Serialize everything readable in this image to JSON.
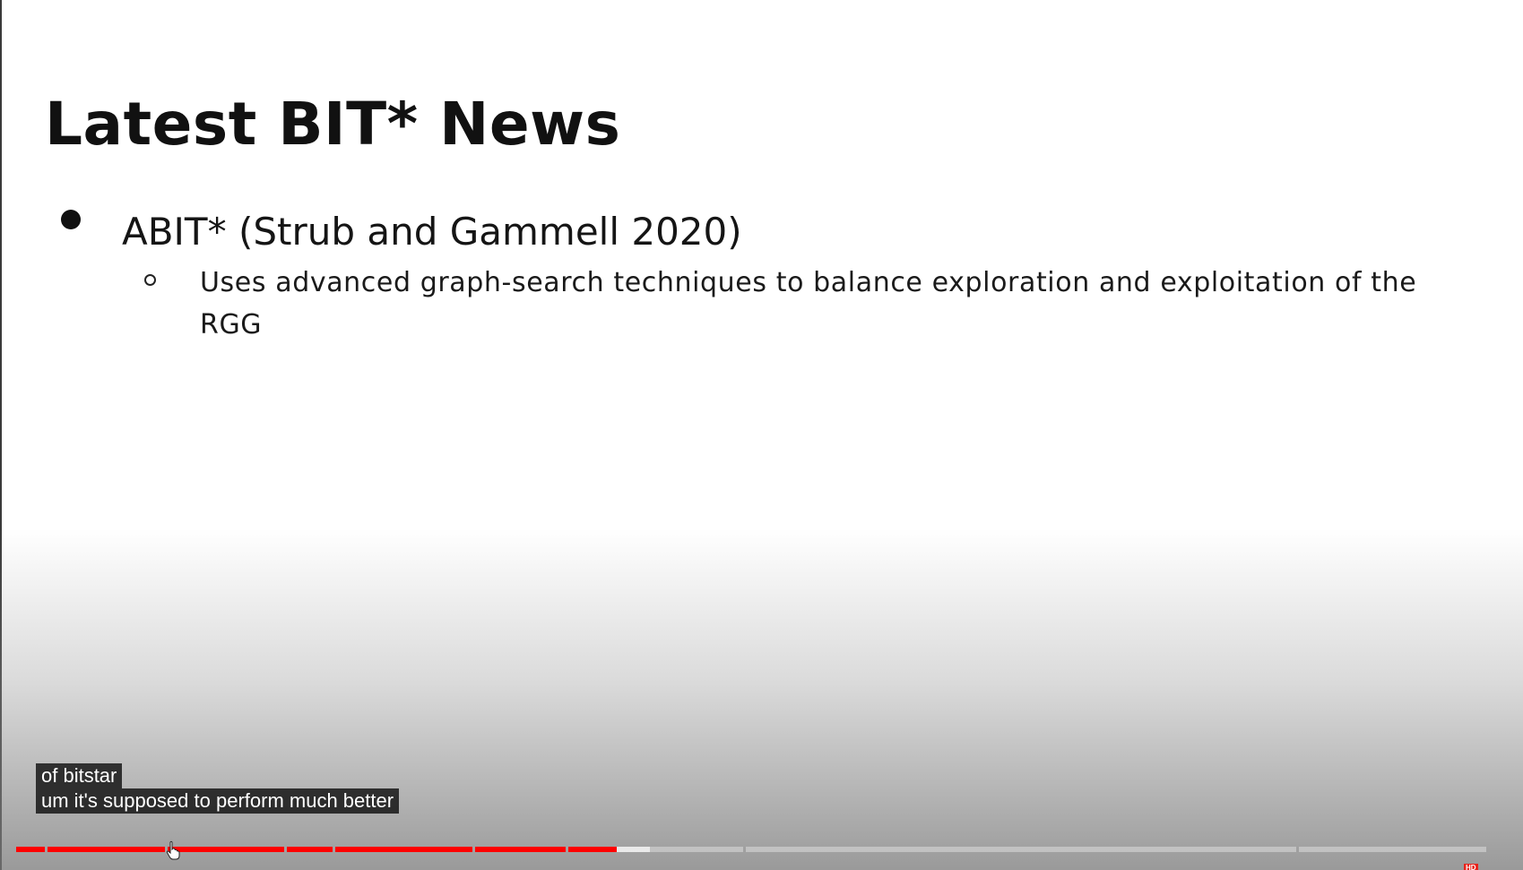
{
  "slide": {
    "title": "Latest BIT* News",
    "bullets": [
      {
        "text": "ABIT* (Strub and Gammell 2020)",
        "sub_bullets": [
          "Uses advanced graph-search techniques to balance exploration and exploitation of the RGG"
        ]
      }
    ]
  },
  "captions": {
    "line1": "of bitstar",
    "line2": "um it's supposed to perform much better"
  },
  "player": {
    "played_fraction": 0.409,
    "buffered_fraction": 0.432,
    "chapter_boundaries": [
      0.0213,
      0.103,
      0.1841,
      0.2171,
      0.3122,
      0.3756,
      0.4963,
      0.8725
    ],
    "quality_badge": "HD",
    "accent_color": "#ff0000"
  }
}
